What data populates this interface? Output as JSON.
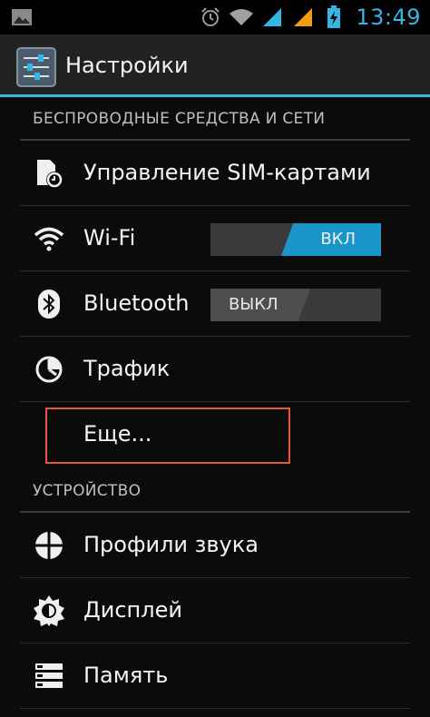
{
  "status_bar": {
    "time": "13:49",
    "icons": [
      "image-icon",
      "alarm-icon",
      "wifi-signal-icon",
      "cell-signal-blue-icon",
      "cell-signal-orange-icon",
      "battery-icon"
    ],
    "accent": "#33b5e5"
  },
  "action_bar": {
    "title": "Настройки",
    "icon": "settings-sliders-icon"
  },
  "sections": {
    "wireless": {
      "header": "БЕСПРОВОДНЫЕ СРЕДСТВА И СЕТИ",
      "items": [
        {
          "label": "Управление SIM-картами",
          "icon": "sim-card-icon"
        },
        {
          "label": "Wi-Fi",
          "icon": "wifi-icon",
          "toggle": "ВКЛ",
          "state": "on"
        },
        {
          "label": "Bluetooth",
          "icon": "bluetooth-icon",
          "toggle": "ВЫКЛ",
          "state": "off"
        },
        {
          "label": "Трафик",
          "icon": "data-usage-icon"
        },
        {
          "label": "Еще..."
        }
      ]
    },
    "device": {
      "header": "УСТРОЙСТВО",
      "items": [
        {
          "label": "Профили звука",
          "icon": "sound-profile-icon"
        },
        {
          "label": "Дисплей",
          "icon": "display-brightness-icon"
        },
        {
          "label": "Память",
          "icon": "storage-icon"
        }
      ]
    }
  },
  "colors": {
    "toggle_on": "#1a95c9",
    "highlight": "#e55a3f"
  }
}
